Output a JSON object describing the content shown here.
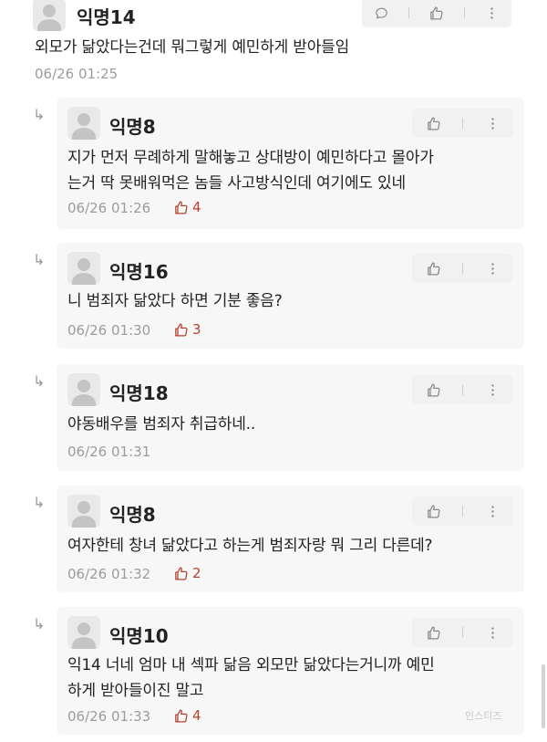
{
  "top": {
    "name": "익명14",
    "text": "외모가 닮았다는건데 뭐그렇게 예민하게 받아들임",
    "time": "06/26 01:25"
  },
  "reply_arrow": "↳",
  "replies": [
    {
      "name": "익명8",
      "lines": [
        "지가 먼저 무례하게 말해놓고 상대방이 예민하다고 몰아가",
        "는거 딱 못배워먹은 놈들 사고방식인데 여기에도 있네"
      ],
      "time": "06/26 01:26",
      "likes": "4"
    },
    {
      "name": "익명16",
      "lines": [
        "니 범죄자 닮았다 하면 기분 좋음?"
      ],
      "time": "06/26 01:30",
      "likes": "3"
    },
    {
      "name": "익명18",
      "lines": [
        "야동배우를 범죄자 취급하네.."
      ],
      "time": "06/26 01:31",
      "likes": ""
    },
    {
      "name": "익명8",
      "lines": [
        "여자한테 창녀 닮았다고 하는게 범죄자랑 뭐 그리 다른데?"
      ],
      "time": "06/26 01:32",
      "likes": "2"
    },
    {
      "name": "익명10",
      "lines": [
        "익14 너네 엄마 내 섹파 닮음 외모만 닮았다는거니까 예민",
        "하게 받아들이진 말고"
      ],
      "time": "06/26 01:33",
      "likes": "4"
    }
  ],
  "icons": {
    "comment": "speech-bubble-icon",
    "like": "thumbs-up-icon",
    "more": "vertical-dots-icon",
    "avatar": "default-avatar-icon"
  },
  "colors": {
    "like_count": "#b2432f",
    "reply_bg": "#f7f7f7",
    "action_bg": "#f1f1f1",
    "meta_text": "#9c9c9c"
  },
  "watermark": "인스티즈"
}
